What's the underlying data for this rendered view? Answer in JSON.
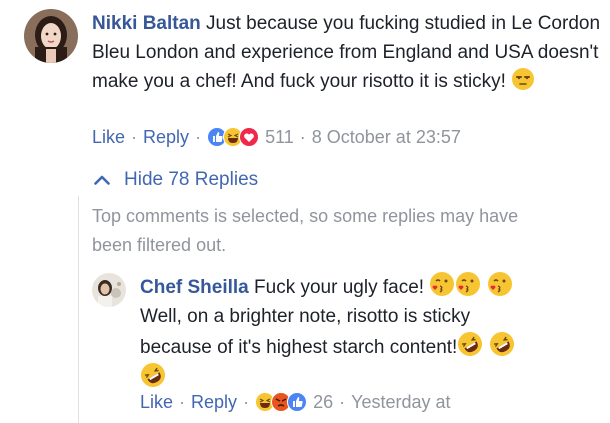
{
  "comment": {
    "author": "Nikki Baltan",
    "text": "Just because you fucking studied in Le Cordon Bleu London and experience from England and USA doesn't make you a chef! And fuck your risotto it is sticky!",
    "like_label": "Like",
    "reply_label": "Reply",
    "reaction_count": "511",
    "timestamp": "8 October at 23:57"
  },
  "hide_replies_label": "Hide 78 Replies",
  "filter_note": "Top comments is selected, so some replies may have been filtered out.",
  "reply": {
    "author": "Chef Sheilla",
    "text_part1": "Fuck your ugly face!",
    "text_part2": "Well, on a brighter note, risotto is sticky because of it's highest starch content!",
    "like_label": "Like",
    "reply_label": "Reply",
    "reaction_count": "26",
    "timestamp": "Yesterday at"
  },
  "icons": {
    "reactions_comment": [
      "like-icon",
      "haha-icon",
      "love-icon"
    ],
    "reactions_reply": [
      "haha-icon",
      "angry-icon",
      "like-icon"
    ],
    "emojis": [
      "unamused-face",
      "kissing-heart-face",
      "rofl-face"
    ]
  },
  "colors": {
    "link_blue": "#4267b2",
    "author_blue": "#365899",
    "meta_gray": "#90949c",
    "text": "#1d2129",
    "divider": "#dddfe2"
  }
}
